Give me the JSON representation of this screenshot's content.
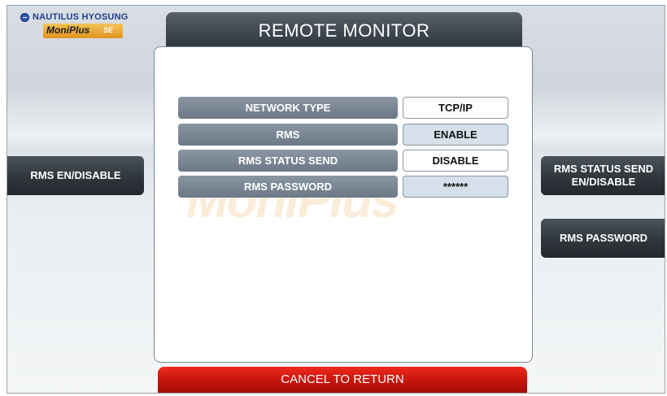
{
  "brand": {
    "company": "NAUTILUS HYOSUNG",
    "product": "MoniPlus",
    "product_suffix": "SE"
  },
  "header": {
    "title": "REMOTE MONITOR"
  },
  "settings": [
    {
      "label": "NETWORK TYPE",
      "value": "TCP/IP"
    },
    {
      "label": "RMS",
      "value": "ENABLE"
    },
    {
      "label": "RMS STATUS SEND",
      "value": "DISABLE"
    },
    {
      "label": "RMS PASSWORD",
      "value": "******"
    }
  ],
  "buttons": {
    "left": "RMS EN/DISABLE",
    "right_1": "RMS STATUS SEND EN/DISABLE",
    "right_2": "RMS PASSWORD",
    "cancel": "CANCEL TO RETURN"
  },
  "colors": {
    "title_bar": "#3c444d",
    "label_bg": "#7b8896",
    "cancel": "#d41a10",
    "accent": "#e0931d"
  }
}
